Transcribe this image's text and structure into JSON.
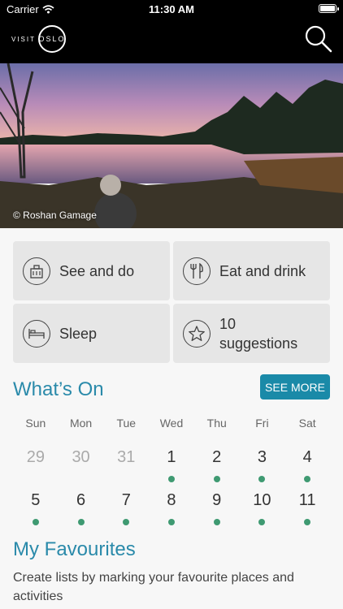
{
  "status_bar": {
    "carrier": "Carrier",
    "time": "11:30 AM"
  },
  "header": {
    "logo_visit": "VISIT",
    "logo_city": "OSLO"
  },
  "hero": {
    "credit": "© Roshan Gamage"
  },
  "tiles": [
    {
      "label": "See and do",
      "icon": "building-icon"
    },
    {
      "label": "Eat and drink",
      "icon": "fork-knife-icon"
    },
    {
      "label": "Sleep",
      "icon": "bed-icon"
    },
    {
      "label": "10 suggestions",
      "icon": "star-icon"
    }
  ],
  "whats_on": {
    "title": "What’s On",
    "see_more": "SEE MORE",
    "weekdays": [
      "Sun",
      "Mon",
      "Tue",
      "Wed",
      "Thu",
      "Fri",
      "Sat"
    ],
    "weeks": [
      [
        {
          "day": "29",
          "past": true,
          "events": false
        },
        {
          "day": "30",
          "past": true,
          "events": false
        },
        {
          "day": "31",
          "past": true,
          "events": false
        },
        {
          "day": "1",
          "past": false,
          "events": true
        },
        {
          "day": "2",
          "past": false,
          "events": true
        },
        {
          "day": "3",
          "past": false,
          "events": true
        },
        {
          "day": "4",
          "past": false,
          "events": true
        }
      ],
      [
        {
          "day": "5",
          "past": false,
          "events": true
        },
        {
          "day": "6",
          "past": false,
          "events": true
        },
        {
          "day": "7",
          "past": false,
          "events": true
        },
        {
          "day": "8",
          "past": false,
          "events": true
        },
        {
          "day": "9",
          "past": false,
          "events": true
        },
        {
          "day": "10",
          "past": false,
          "events": true
        },
        {
          "day": "11",
          "past": false,
          "events": true
        }
      ]
    ]
  },
  "favourites": {
    "title": "My Favourites",
    "description": "Create lists by marking your favourite places and activities"
  },
  "colors": {
    "accent": "#2a8aaa",
    "button": "#1a8aa8",
    "event_dot": "#3f9a72"
  }
}
